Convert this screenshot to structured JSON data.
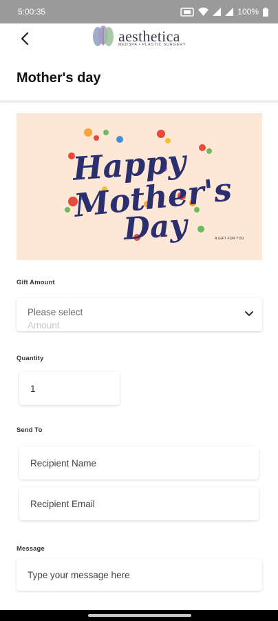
{
  "status_bar": {
    "time": "5:00:35",
    "battery": "100%",
    "icons": [
      "nfc-icon",
      "wifi-icon",
      "signal-icon",
      "signal-icon",
      "battery-icon"
    ]
  },
  "header": {
    "brand_name": "aesthetica",
    "brand_tagline": "MEDSPA • PLASTIC SURGERY",
    "back_icon": "back-arrow-icon"
  },
  "page": {
    "title": "Mother's day"
  },
  "gift_card": {
    "caption": "A GIFT FOR YOU",
    "line1": "Happy",
    "line2": "Mother's",
    "line3": "Day"
  },
  "form": {
    "gift_amount": {
      "label": "Gift Amount",
      "placeholder": "Please select",
      "ghost_option": "Amount"
    },
    "quantity": {
      "label": "Quantity",
      "value": "1"
    },
    "send_to": {
      "label": "Send To",
      "recipient_name_placeholder": "Recipient Name",
      "recipient_email_placeholder": "Recipient Email"
    },
    "message": {
      "label": "Message",
      "placeholder": "Type your message here"
    }
  },
  "colors": {
    "card_background": "#fde8d8",
    "lettering": "#2b2f6e",
    "status_bar": "#9a9a9a"
  }
}
